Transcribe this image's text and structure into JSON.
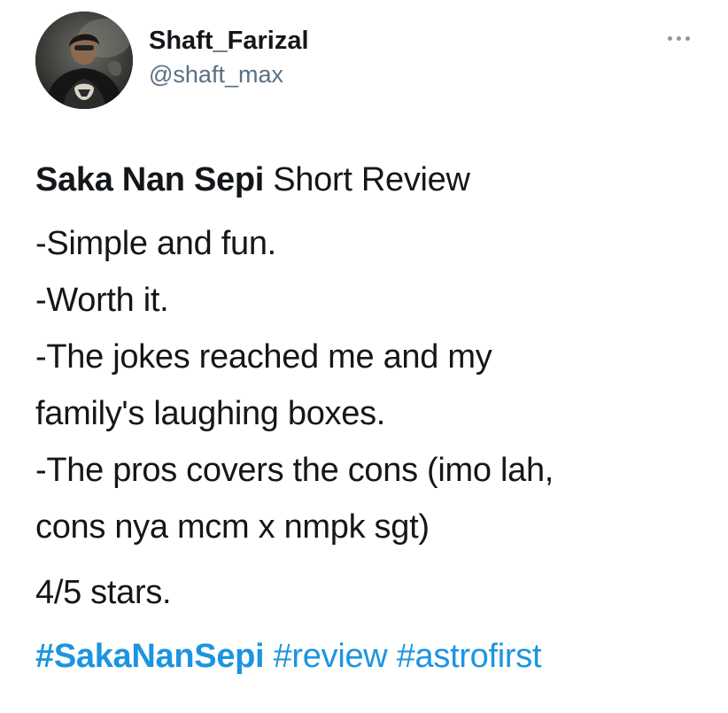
{
  "user": {
    "display_name": "Shaft_Farizal",
    "handle": "@shaft_max"
  },
  "icons": {
    "avatar": "profile-photo",
    "more": "more-options-icon"
  },
  "tweet": {
    "title_bold": "Saka Nan Sepi",
    "title_rest": " Short Review",
    "lines": [
      "-Simple and fun.",
      "-Worth it.",
      "-The jokes reached me and my",
      "family's laughing boxes.",
      "-The pros covers the cons (imo lah,",
      "cons nya mcm x nmpk sgt)"
    ],
    "rating": "4/5 stars.",
    "hashtags": [
      "#SakaNanSepi",
      "#review",
      "#astrofirst"
    ]
  },
  "colors": {
    "text": "#14171a",
    "handle": "#5b7083",
    "link": "#1b95e0"
  }
}
